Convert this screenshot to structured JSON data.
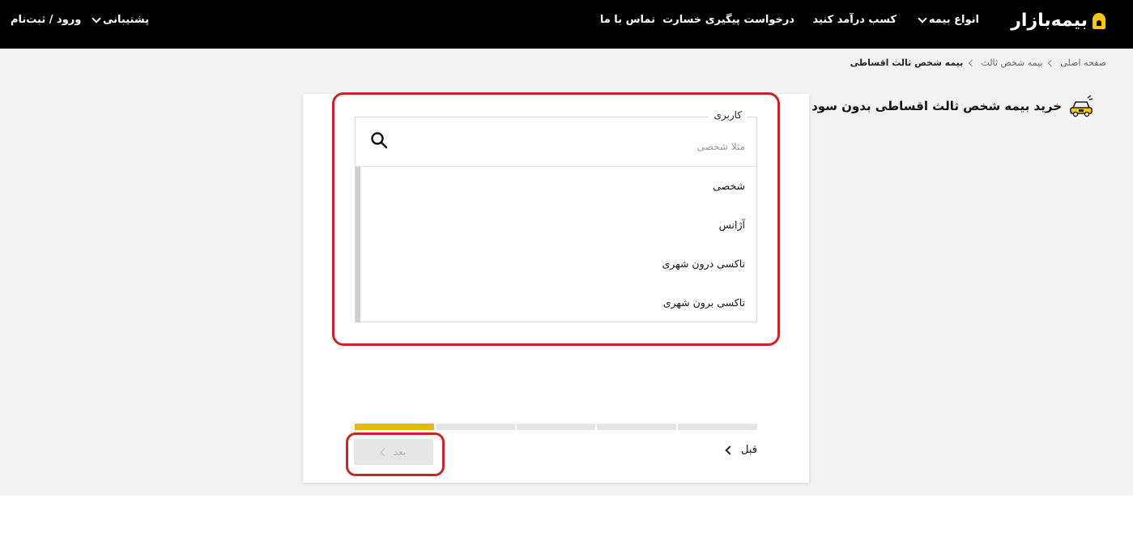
{
  "header": {
    "logo_text": "بیمه‌بازار",
    "nav": {
      "insurance_types": "انواع بیمه",
      "earn_money": "کسب درآمد کنید",
      "claim_tracking": "درخواست پیگیری خسارت",
      "contact_us": "تماس با ما",
      "support": "پشتیبانی",
      "login": "ورود / ثبت‌نام"
    }
  },
  "breadcrumb": {
    "home": "صفحه اصلی",
    "third_party": "بیمه شخص ثالث",
    "current": "بیمه شخص ثالث اقساطی"
  },
  "page_title": "خرید بیمه شخص ثالث اقساطی بدون سود",
  "usage_select": {
    "legend": "کاربری",
    "search_placeholder": "مثلا شخصی",
    "search_value": "",
    "options": [
      "شخصی",
      "آژانس",
      "تاکسی درون شهری",
      "تاکسی برون شهری"
    ]
  },
  "progress": {
    "total_steps": 5,
    "current_step": 1
  },
  "buttons": {
    "prev": "قبل",
    "next": "بعد"
  },
  "colors": {
    "header_bg": "#000000",
    "accent": "#e8b70c",
    "annotation": "#c8242c"
  },
  "icons": {
    "search": "search-icon",
    "car": "car-icon",
    "logo": "logo-icon"
  }
}
